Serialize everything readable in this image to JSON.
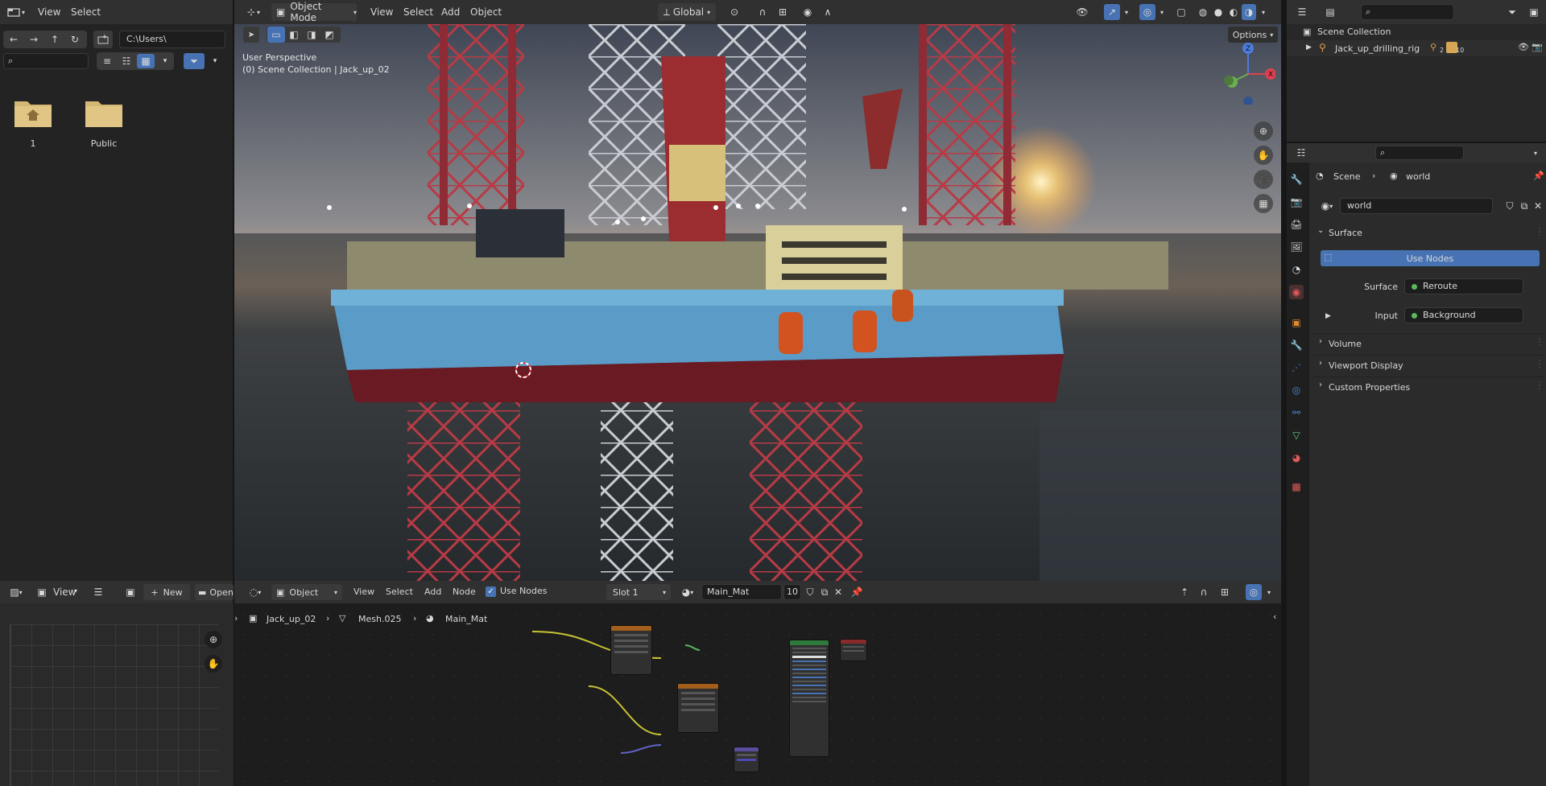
{
  "file_browser": {
    "menu": [
      "View",
      "Select"
    ],
    "path": "C:\\Users\\",
    "search_placeholder": "",
    "folders": [
      {
        "label": "1",
        "icon": "home-folder-icon"
      },
      {
        "label": "Public",
        "icon": "folder-icon"
      }
    ]
  },
  "viewport": {
    "mode": "Object Mode",
    "menu": [
      "View",
      "Select",
      "Add",
      "Object"
    ],
    "transform_orientation": "Global",
    "options_label": "Options",
    "overlay_line1": "User Perspective",
    "overlay_line2": "(0) Scene Collection | Jack_up_02",
    "gizmo_axes": {
      "z": "Z",
      "x": "X"
    }
  },
  "outliner": {
    "root": "Scene Collection",
    "item": "Jack_up_drilling_rig",
    "item_badges": {
      "a": "2",
      "b": "10"
    }
  },
  "properties": {
    "breadcrumb": {
      "scene": "Scene",
      "world": "world"
    },
    "world_name": "world",
    "surface_section": "Surface",
    "use_nodes_label": "Use Nodes",
    "surface_label": "Surface",
    "surface_value": "Reroute",
    "input_label": "Input",
    "input_value": "Background",
    "sections": [
      "Volume",
      "Viewport Display",
      "Custom Properties"
    ]
  },
  "image_editor": {
    "view_label": "View",
    "new_label": "New",
    "open_label": "Open"
  },
  "node_editor": {
    "object_type": "Object",
    "menu": [
      "View",
      "Select",
      "Add",
      "Node"
    ],
    "use_nodes_label": "Use Nodes",
    "slot": "Slot 1",
    "material": "Main_Mat",
    "users": "10",
    "breadcrumb": {
      "object": "Jack_up_02",
      "mesh": "Mesh.025",
      "material": "Main_Mat"
    }
  },
  "colors": {
    "accent_blue": "#4772b3",
    "header": "#303030",
    "panel": "#2b2b2b",
    "editor_bg": "#1d1d1d"
  }
}
